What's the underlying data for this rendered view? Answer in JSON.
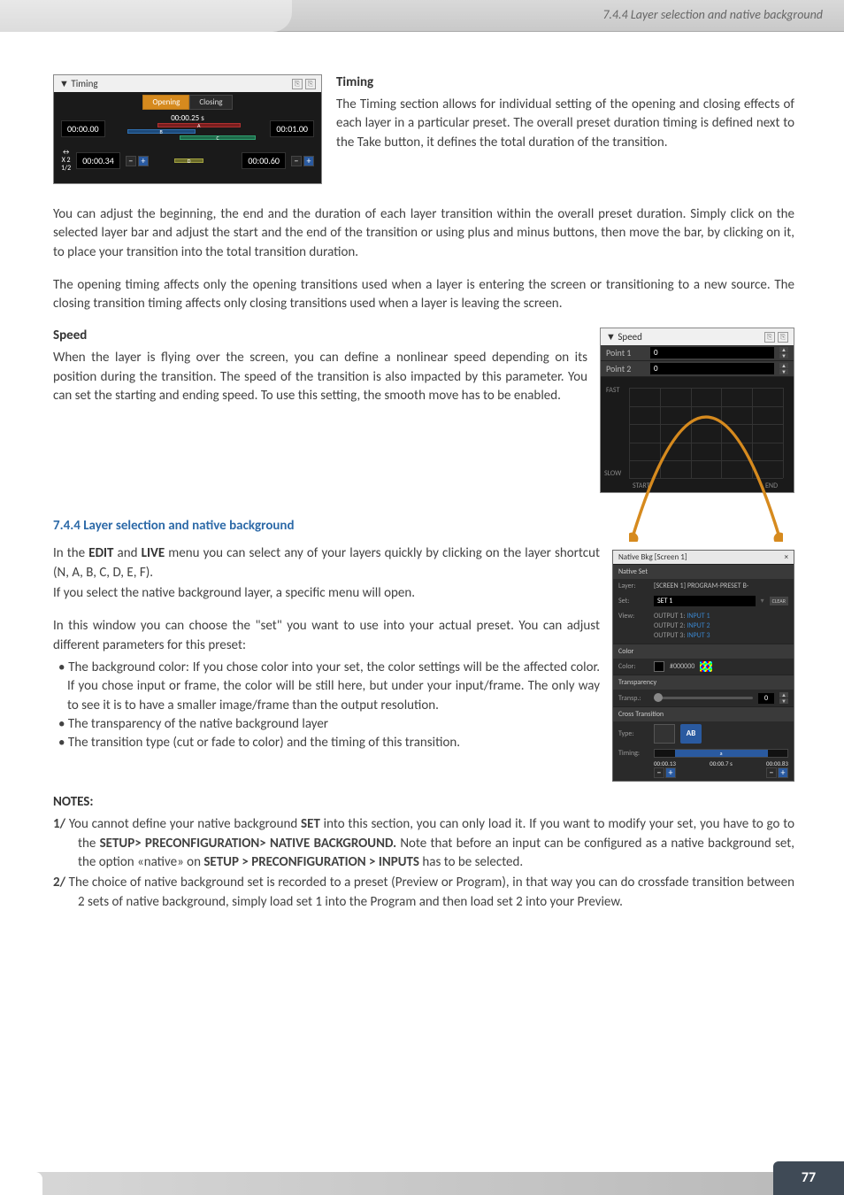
{
  "header": {
    "breadcrumb": "7.4.4 Layer selection and native background"
  },
  "timing_panel": {
    "title": "▼ Timing",
    "tabs": {
      "opening": "Opening",
      "closing": "Closing"
    },
    "start_time": "00:00.00",
    "duration": "00:00.25 s",
    "end_time": "00:01.00",
    "bars": {
      "a": "A",
      "b": "B",
      "c": "C",
      "d": "D"
    },
    "controls": {
      "kx": "↔\nX 2\n1/2"
    },
    "bottom_left_time": "00:00.34",
    "bottom_right_time": "00:00.60"
  },
  "timing_heading": "Timing",
  "timing_intro": "The Timing section allows for individual setting of the opening and closing effects of each layer in a particular preset.  The overall preset duration timing is defined next to the Take button, it defines the total duration of the transition.",
  "timing_p2": "You can adjust the beginning, the end and the duration of each layer transition within the overall preset duration. Simply click on the selected layer bar and adjust the start and the end of the transition or using plus and minus buttons, then move the bar, by clicking on it, to place your transition into the total transition duration.",
  "timing_p3": "The opening timing affects only the opening transitions used when a layer is entering the screen or transitioning to a new source.  The closing transition timing affects only closing transitions used when a layer is leaving the screen.",
  "speed_heading": "Speed",
  "speed_para": "When the layer is flying over the screen, you can define a nonlinear speed depending on its position during the transition. The speed of the transition is also impacted by this parameter. You can set the starting and ending speed.  To use this setting, the smooth move has to be enabled.",
  "speed_panel": {
    "title": "▼ Speed",
    "point1_label": "Point 1",
    "point1_val": "0",
    "point2_label": "Point 2",
    "point2_val": "0",
    "fast": "FAST",
    "slow": "SLOW",
    "start": "START",
    "end": "END"
  },
  "section_744": "7.4.4 Layer selection and native background",
  "p744_1a": "In the ",
  "p744_1_edit": "EDIT",
  "p744_1b": " and ",
  "p744_1_live": "LIVE",
  "p744_1c": " menu you can select any of your layers quickly by clicking on the layer shortcut (N, A, B, C, D, E, F).",
  "p744_2": "If you select the native background layer, a specific menu will open.",
  "p744_3": "In this window you can choose the \"set\" you want to use into your actual preset. You can adjust different parameters for this preset:",
  "bullet1": "The background color: If you chose color into your set, the color settings will be the affected color. If you chose input or frame, the color will be still here, but under your input/frame. The only way to see it is to have a smaller image/frame than the output resolution.",
  "bullet2": "The transparency of the native background layer",
  "bullet3": "The transition type (cut or fade to color) and the timing of this transition.",
  "native_panel": {
    "title": "Native Bkg [Screen 1]",
    "sec_set": "Native Set",
    "layer_lbl": "Layer:",
    "layer_val": "[SCREEN 1] PROGRAM-PRESET B-",
    "set_lbl": "Set:",
    "set_val": "SET 1",
    "set_badge": "CLEAR",
    "view_lbl": "View:",
    "view_o1": "OUTPUT 1: ",
    "view_i1": "INPUT 1",
    "view_o2": "OUTPUT 2: ",
    "view_i2": "INPUT 2",
    "view_o3": "OUTPUT 3: ",
    "view_i3": "INPUT 3",
    "sec_color": "Color",
    "color_lbl": "Color:",
    "color_val": "#000000",
    "sec_transp": "Transparency",
    "transp_lbl": "Transp.:",
    "transp_val": "0",
    "sec_cross": "Cross Transition",
    "type_lbl": "Type:",
    "type_val": "AB",
    "timing_lbl": "Timing:",
    "t_seg": "a",
    "t_start": "00:00.13",
    "t_mid": "00:00.7 s",
    "t_end": "00:00.83"
  },
  "notes_heading": "NOTES:",
  "note1_num": "1/ ",
  "note1_a": "You cannot define your native background ",
  "note1_set": "SET",
  "note1_b": " into this section, you can only load it. If you want to modify your set, you have to go to the ",
  "note1_path1": "SETUP> PRECONFIGURATION> NATIVE BACKGROUND.",
  "note1_c": " Note that before an input can be configured as a native background set, the option «native» on ",
  "note1_path2": "SETUP > PRECONFIGURATION > INPUTS",
  "note1_d": " has to be selected.",
  "note2_num": "2/ ",
  "note2": "The choice of native background set is recorded to a preset (Preview or Program), in that way you can do crossfade transition between 2 sets of native background, simply load set 1 into the Program and then load set 2 into your Preview.",
  "page_num": "77"
}
